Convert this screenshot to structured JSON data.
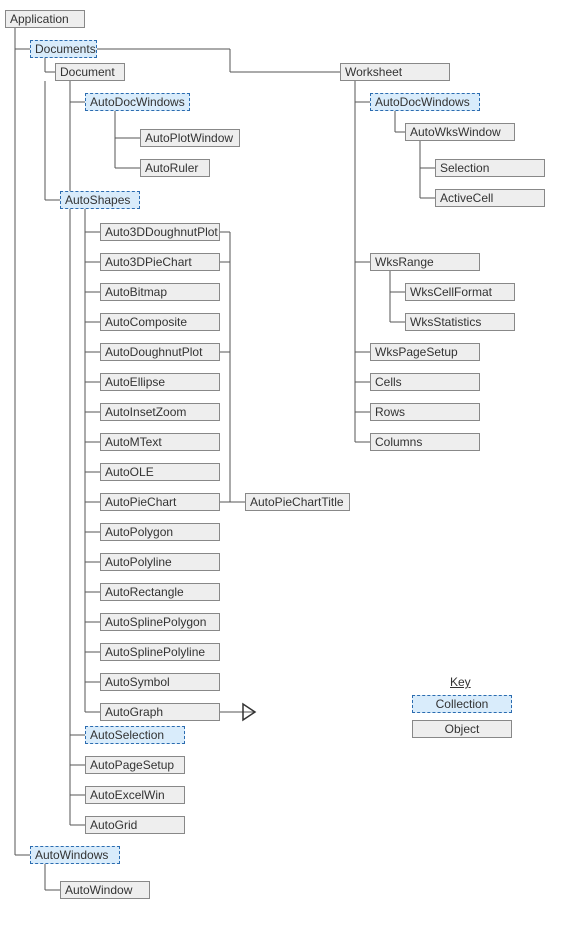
{
  "nodes": {
    "application": {
      "label": "Application",
      "type": "obj"
    },
    "documents": {
      "label": "Documents",
      "type": "coll"
    },
    "document": {
      "label": "Document",
      "type": "obj"
    },
    "autodocwindows1": {
      "label": "AutoDocWindows",
      "type": "coll"
    },
    "autoplotwindow": {
      "label": "AutoPlotWindow",
      "type": "obj"
    },
    "autoruler": {
      "label": "AutoRuler",
      "type": "obj"
    },
    "autoshapes": {
      "label": "AutoShapes",
      "type": "coll"
    },
    "shape_auto3ddoughnut": {
      "label": "Auto3DDoughnutPlot",
      "type": "obj"
    },
    "shape_auto3dpie": {
      "label": "Auto3DPieChart",
      "type": "obj"
    },
    "shape_autobitmap": {
      "label": "AutoBitmap",
      "type": "obj"
    },
    "shape_autocomposite": {
      "label": "AutoComposite",
      "type": "obj"
    },
    "shape_autodoughnut": {
      "label": "AutoDoughnutPlot",
      "type": "obj"
    },
    "shape_autoellipse": {
      "label": "AutoEllipse",
      "type": "obj"
    },
    "shape_autoinset": {
      "label": "AutoInsetZoom",
      "type": "obj"
    },
    "shape_automtext": {
      "label": "AutoMText",
      "type": "obj"
    },
    "shape_autoole": {
      "label": "AutoOLE",
      "type": "obj"
    },
    "shape_autopie": {
      "label": "AutoPieChart",
      "type": "obj"
    },
    "shape_autopolygon": {
      "label": "AutoPolygon",
      "type": "obj"
    },
    "shape_autopolyline": {
      "label": "AutoPolyline",
      "type": "obj"
    },
    "shape_autorect": {
      "label": "AutoRectangle",
      "type": "obj"
    },
    "shape_autosplinepolygon": {
      "label": "AutoSplinePolygon",
      "type": "obj"
    },
    "shape_autosplinepolyline": {
      "label": "AutoSplinePolyline",
      "type": "obj"
    },
    "shape_autosymbol": {
      "label": "AutoSymbol",
      "type": "obj"
    },
    "shape_autograph": {
      "label": "AutoGraph",
      "type": "obj"
    },
    "autopiecharttitle": {
      "label": "AutoPieChartTitle",
      "type": "obj"
    },
    "autoselection": {
      "label": "AutoSelection",
      "type": "coll"
    },
    "autopagesetup": {
      "label": "AutoPageSetup",
      "type": "obj"
    },
    "autoexcelwin": {
      "label": "AutoExcelWin",
      "type": "obj"
    },
    "autogrid": {
      "label": "AutoGrid",
      "type": "obj"
    },
    "autowindows": {
      "label": "AutoWindows",
      "type": "coll"
    },
    "autowindow": {
      "label": "AutoWindow",
      "type": "obj"
    },
    "worksheet": {
      "label": "Worksheet",
      "type": "obj"
    },
    "autodocwindows2": {
      "label": "AutoDocWindows",
      "type": "coll"
    },
    "autowkswindow": {
      "label": "AutoWksWindow",
      "type": "obj"
    },
    "selection": {
      "label": "Selection",
      "type": "obj"
    },
    "activecell": {
      "label": "ActiveCell",
      "type": "obj"
    },
    "wksrange": {
      "label": "WksRange",
      "type": "obj"
    },
    "wkscellformat": {
      "label": "WksCellFormat",
      "type": "obj"
    },
    "wksstatistics": {
      "label": "WksStatistics",
      "type": "obj"
    },
    "wkspagesetup": {
      "label": "WksPageSetup",
      "type": "obj"
    },
    "cells": {
      "label": "Cells",
      "type": "obj"
    },
    "rows": {
      "label": "Rows",
      "type": "obj"
    },
    "columns": {
      "label": "Columns",
      "type": "obj"
    }
  },
  "key": {
    "title": "Key",
    "collection": "Collection",
    "object": "Object"
  }
}
